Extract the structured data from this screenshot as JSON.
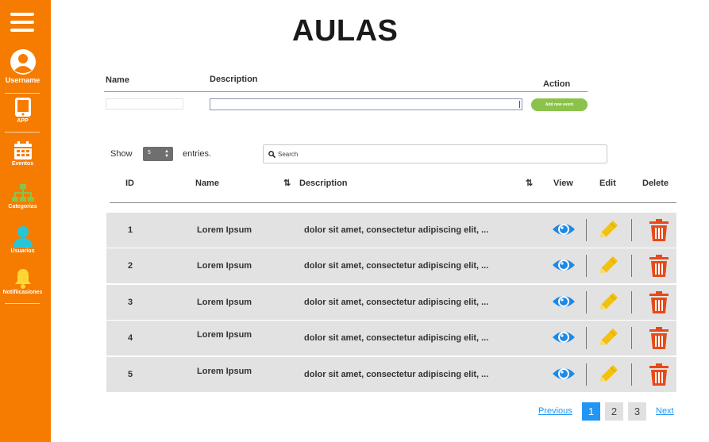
{
  "sidebar": {
    "username": "Username",
    "items": [
      {
        "label": "APP",
        "icon": "tablet-icon"
      },
      {
        "label": "Eventos",
        "icon": "calendar-icon"
      },
      {
        "label": "Categorias",
        "icon": "hierarchy-icon"
      },
      {
        "label": "Usuarios",
        "icon": "user-icon"
      },
      {
        "label": "Notifiicasiones",
        "icon": "bell-icon"
      }
    ],
    "color": "#f57c00"
  },
  "page": {
    "title": "AULAS"
  },
  "form": {
    "name_label": "Name",
    "description_label": "Description",
    "action_label": "Action",
    "name_value": "",
    "description_value": "",
    "add_button_label": "Add new event",
    "add_button_color": "#8bc34a"
  },
  "controls": {
    "show_label": "Show",
    "entries_value": "5",
    "entries_label": "entries.",
    "search_placeholder": "Search"
  },
  "table": {
    "headers": {
      "id": "ID",
      "name": "Name",
      "description": "Description",
      "view": "View",
      "edit": "Edit",
      "delete": "Delete"
    },
    "rows": [
      {
        "id": "1",
        "name": "Lorem Ipsum",
        "description": "dolor sit amet, consectetur adipiscing elit, ..."
      },
      {
        "id": "2",
        "name": "Lorem Ipsum",
        "description": "dolor sit amet, consectetur adipiscing elit, ..."
      },
      {
        "id": "3",
        "name": "Lorem Ipsum",
        "description": "dolor sit amet, consectetur adipiscing elit, ..."
      },
      {
        "id": "4",
        "name": "Lorem Ipsum",
        "description": "dolor sit amet, consectetur adipiscing elit, ..."
      },
      {
        "id": "5",
        "name": "Lorem Ipsum",
        "description": "dolor sit amet, consectetur adipiscing elit, ..."
      }
    ],
    "colors": {
      "view": "#1e88e5",
      "edit": "#f4c20d",
      "delete": "#e64a19"
    }
  },
  "pagination": {
    "previous_label": "Previous",
    "pages": [
      "1",
      "2",
      "3"
    ],
    "current_page": "1",
    "next_label": "Next",
    "accent": "#2196f3"
  }
}
